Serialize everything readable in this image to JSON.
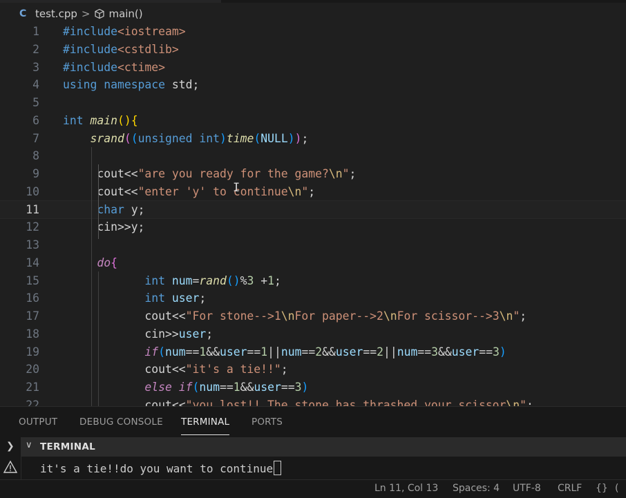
{
  "breadcrumb": {
    "file": "test.cpp",
    "file_icon": "C",
    "symbol": "main()",
    "separator": ">"
  },
  "code_lines": [
    {
      "n": "1",
      "tokens": [
        [
          "pp",
          "#include"
        ],
        [
          "inc",
          "<iostream>"
        ]
      ]
    },
    {
      "n": "2",
      "tokens": [
        [
          "pp",
          "#include"
        ],
        [
          "inc",
          "<cstdlib>"
        ]
      ]
    },
    {
      "n": "3",
      "tokens": [
        [
          "pp",
          "#include"
        ],
        [
          "inc",
          "<ctime>"
        ]
      ]
    },
    {
      "n": "4",
      "tokens": [
        [
          "kw",
          "using"
        ],
        [
          "op",
          " "
        ],
        [
          "kw",
          "namespace"
        ],
        [
          "op",
          " std;"
        ]
      ]
    },
    {
      "n": "5",
      "tokens": []
    },
    {
      "n": "6",
      "tokens": [
        [
          "kw",
          "int"
        ],
        [
          "op",
          " "
        ],
        [
          "fn",
          "main"
        ],
        [
          "br1",
          "()"
        ],
        [
          "br1",
          "{"
        ]
      ]
    },
    {
      "n": "7",
      "tokens": [
        [
          "op",
          "    "
        ],
        [
          "fn",
          "srand"
        ],
        [
          "br2",
          "("
        ],
        [
          "br3",
          "("
        ],
        [
          "kw",
          "unsigned int"
        ],
        [
          "br3",
          ")"
        ],
        [
          "fn",
          "time"
        ],
        [
          "br3",
          "("
        ],
        [
          "var",
          "NULL"
        ],
        [
          "br3",
          ")"
        ],
        [
          "br2",
          ")"
        ],
        [
          "op",
          ";"
        ]
      ]
    },
    {
      "n": "8",
      "tokens": []
    },
    {
      "n": "9",
      "tokens": [
        [
          "op",
          "     cout<<"
        ],
        [
          "str",
          "\"are you ready for the game?"
        ],
        [
          "esc",
          "\\n"
        ],
        [
          "str",
          "\""
        ],
        [
          "op",
          ";"
        ]
      ]
    },
    {
      "n": "10",
      "tokens": [
        [
          "op",
          "     cout<<"
        ],
        [
          "str",
          "\"enter 'y' to continue"
        ],
        [
          "esc",
          "\\n"
        ],
        [
          "str",
          "\""
        ],
        [
          "op",
          ";"
        ]
      ]
    },
    {
      "n": "11",
      "tokens": [
        [
          "op",
          "     "
        ],
        [
          "kw",
          "char"
        ],
        [
          "op",
          " y;"
        ]
      ],
      "current": true
    },
    {
      "n": "12",
      "tokens": [
        [
          "op",
          "     cin>>y;"
        ]
      ]
    },
    {
      "n": "13",
      "tokens": []
    },
    {
      "n": "14",
      "tokens": [
        [
          "op",
          "     "
        ],
        [
          "ctl",
          "do"
        ],
        [
          "br2",
          "{"
        ]
      ]
    },
    {
      "n": "15",
      "tokens": [
        [
          "op",
          "            "
        ],
        [
          "kw",
          "int"
        ],
        [
          "op",
          " "
        ],
        [
          "var",
          "num"
        ],
        [
          "op",
          "="
        ],
        [
          "fn",
          "rand"
        ],
        [
          "br3",
          "()"
        ],
        [
          "op",
          "%"
        ],
        [
          "num",
          "3"
        ],
        [
          "op",
          " +"
        ],
        [
          "num",
          "1"
        ],
        [
          "op",
          ";"
        ]
      ]
    },
    {
      "n": "16",
      "tokens": [
        [
          "op",
          "            "
        ],
        [
          "kw",
          "int"
        ],
        [
          "op",
          " "
        ],
        [
          "var",
          "user"
        ],
        [
          "op",
          ";"
        ]
      ]
    },
    {
      "n": "17",
      "tokens": [
        [
          "op",
          "            cout<<"
        ],
        [
          "str",
          "\"For stone-->1"
        ],
        [
          "esc",
          "\\n"
        ],
        [
          "str",
          "For paper-->2"
        ],
        [
          "esc",
          "\\n"
        ],
        [
          "str",
          "For scissor-->3"
        ],
        [
          "esc",
          "\\n"
        ],
        [
          "str",
          "\""
        ],
        [
          "op",
          ";"
        ]
      ]
    },
    {
      "n": "18",
      "tokens": [
        [
          "op",
          "            cin>>"
        ],
        [
          "var",
          "user"
        ],
        [
          "op",
          ";"
        ]
      ]
    },
    {
      "n": "19",
      "tokens": [
        [
          "op",
          "            "
        ],
        [
          "ctl",
          "if"
        ],
        [
          "br3",
          "("
        ],
        [
          "var",
          "num"
        ],
        [
          "op",
          "=="
        ],
        [
          "num",
          "1"
        ],
        [
          "op",
          "&&"
        ],
        [
          "var",
          "user"
        ],
        [
          "op",
          "=="
        ],
        [
          "num",
          "1"
        ],
        [
          "op",
          "||"
        ],
        [
          "var",
          "num"
        ],
        [
          "op",
          "=="
        ],
        [
          "num",
          "2"
        ],
        [
          "op",
          "&&"
        ],
        [
          "var",
          "user"
        ],
        [
          "op",
          "=="
        ],
        [
          "num",
          "2"
        ],
        [
          "op",
          "||"
        ],
        [
          "var",
          "num"
        ],
        [
          "op",
          "=="
        ],
        [
          "num",
          "3"
        ],
        [
          "op",
          "&&"
        ],
        [
          "var",
          "user"
        ],
        [
          "op",
          "=="
        ],
        [
          "num",
          "3"
        ],
        [
          "br3",
          ")"
        ]
      ]
    },
    {
      "n": "20",
      "tokens": [
        [
          "op",
          "            cout<<"
        ],
        [
          "str",
          "\"it's a tie!!\""
        ],
        [
          "op",
          ";"
        ]
      ]
    },
    {
      "n": "21",
      "tokens": [
        [
          "op",
          "            "
        ],
        [
          "ctl",
          "else if"
        ],
        [
          "br3",
          "("
        ],
        [
          "var",
          "num"
        ],
        [
          "op",
          "=="
        ],
        [
          "num",
          "1"
        ],
        [
          "op",
          "&&"
        ],
        [
          "var",
          "user"
        ],
        [
          "op",
          "=="
        ],
        [
          "num",
          "3"
        ],
        [
          "br3",
          ")"
        ]
      ]
    },
    {
      "n": "22",
      "tokens": [
        [
          "op",
          "            cout<<"
        ],
        [
          "str",
          "\"you lost!! The stone has thrashed your scissor"
        ],
        [
          "esc",
          "\\n"
        ],
        [
          "str",
          "\""
        ],
        [
          "op",
          ";"
        ]
      ]
    }
  ],
  "panel": {
    "tabs": [
      {
        "label": "OUTPUT"
      },
      {
        "label": "DEBUG CONSOLE"
      },
      {
        "label": "TERMINAL",
        "active": true
      },
      {
        "label": "PORTS"
      }
    ],
    "terminal_header": "TERMINAL",
    "terminal_output": "it's a tie!!do you want to continue"
  },
  "status": {
    "position": "Ln 11, Col 13",
    "spaces": "Spaces: 4",
    "encoding": "UTF-8",
    "eol": "CRLF",
    "language_icon": "{}"
  },
  "colors": {
    "editor_bg": "#1f1f1f",
    "keyword": "#569cd6",
    "function": "#dcdcaa",
    "string": "#ce9178",
    "number": "#b5cea8",
    "variable": "#9cdcfe",
    "control": "#c586c0"
  }
}
